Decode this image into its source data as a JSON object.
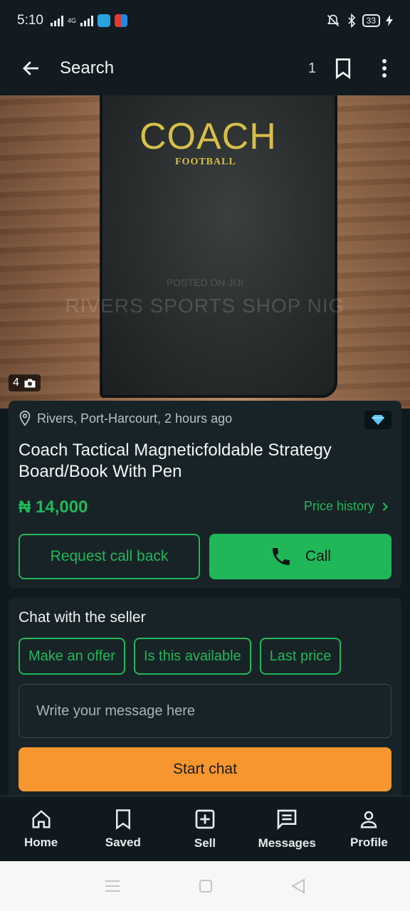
{
  "status_bar": {
    "time": "5:10",
    "network_label": "4G",
    "battery": "33"
  },
  "app_bar": {
    "back_icon": "arrow-left-icon",
    "title": "Search",
    "saved_count": "1",
    "bookmark_icon": "bookmark-icon",
    "more_icon": "more-vert-icon"
  },
  "hero": {
    "cover_text": "COACH",
    "cover_subtext": "FOOTBALL",
    "watermark_small": "POSTED ON JIJI",
    "watermark": "RIVERS SPORTS SHOP NIG",
    "photo_count": "4",
    "camera_icon": "camera-icon"
  },
  "listing": {
    "location": "Rivers, Port-Harcourt, 2 hours ago",
    "location_icon": "location-pin-icon",
    "badge_icon": "diamond-icon",
    "title": "Coach Tactical Magneticfoldable Strategy Board/Book With Pen",
    "price": "₦ 14,000",
    "price_history_label": "Price history",
    "request_call_label": "Request call back",
    "call_label": "Call",
    "accent_color": "#20b759"
  },
  "chat": {
    "title": "Chat with the seller",
    "chips": [
      "Make an offer",
      "Is this available",
      "Last price"
    ],
    "message_placeholder": "Write your message here",
    "start_chat_label": "Start chat",
    "start_chat_color": "#f7962e"
  },
  "bottom_nav": {
    "items": [
      {
        "label": "Home",
        "icon": "home-icon"
      },
      {
        "label": "Saved",
        "icon": "bookmark-icon"
      },
      {
        "label": "Sell",
        "icon": "add-box-icon"
      },
      {
        "label": "Messages",
        "icon": "message-icon"
      },
      {
        "label": "Profile",
        "icon": "person-icon"
      }
    ]
  }
}
